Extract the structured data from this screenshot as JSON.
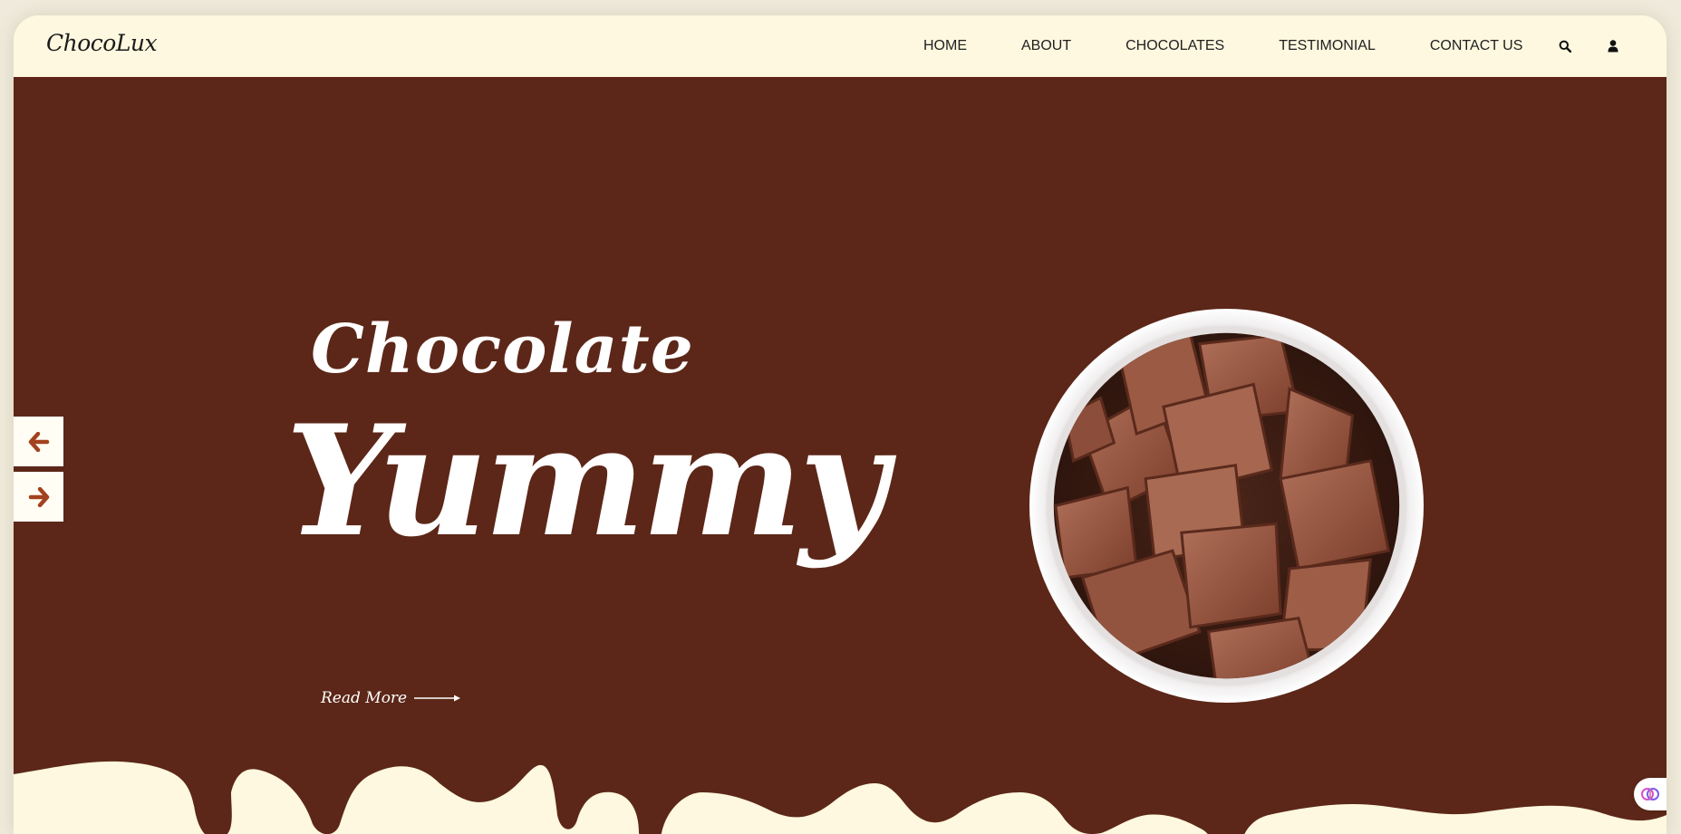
{
  "brand": {
    "logo_text": "ChocoLux"
  },
  "nav": {
    "items": [
      {
        "label": "HOME"
      },
      {
        "label": "ABOUT"
      },
      {
        "label": "CHOCOLATES"
      },
      {
        "label": "TESTIMONIAL"
      },
      {
        "label": "CONTACT US"
      }
    ],
    "icons": [
      "search-icon",
      "user-icon"
    ]
  },
  "hero": {
    "title_small": "Chocolate",
    "title_big": "Yummy",
    "read_more": "Read More",
    "image": "bowl-of-chocolate-pieces"
  },
  "slider": {
    "prev_icon": "arrow-left-icon",
    "next_icon": "arrow-right-icon"
  },
  "widget": {
    "icon": "brain-icon"
  },
  "colors": {
    "cream": "#fdf8df",
    "chocolate": "#5c2718",
    "arrow": "#a3421f",
    "text_dark": "#1f1f1f"
  }
}
